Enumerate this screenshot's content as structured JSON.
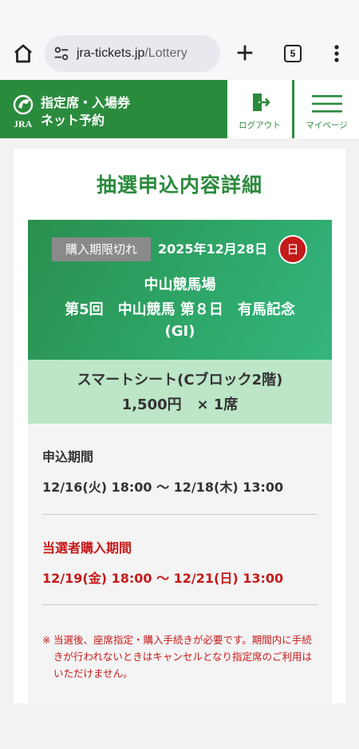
{
  "browser": {
    "url_host": "jra-tickets.jp",
    "url_path": "/Lottery",
    "tab_count": "5"
  },
  "header": {
    "logo_line1": "指定席・入場券",
    "logo_line2": "ネット予約",
    "logo_jra": "JRA",
    "logout_label": "ログアウト",
    "mypage_label": "マイページ",
    "brand_color": "#2b8b3d"
  },
  "main": {
    "title": "抽選申込内容詳細",
    "race": {
      "status_badge": "購入期限切れ",
      "date": "2025年12月28日",
      "weekday": "日",
      "venue": "中山競馬場",
      "race_name": "第5回　中山競馬 第８日　有馬記念",
      "grade": "(GI)"
    },
    "seat": {
      "name": "スマートシート(Cブロック2階)",
      "price": "1,500円",
      "quantity": "× 1席"
    },
    "periods": {
      "apply_label": "申込期間",
      "apply_value": "12/16(火) 18:00 〜 12/18(木) 13:00",
      "winner_label": "当選者購入期間",
      "winner_value": "12/19(金) 18:00 〜 12/21(日) 13:00"
    },
    "note_mark": "※",
    "note_text": "当選後、座席指定・購入手続きが必要です。期間内に手続きが行われないときはキャンセルとなり指定席のご利用はいただけません。"
  }
}
